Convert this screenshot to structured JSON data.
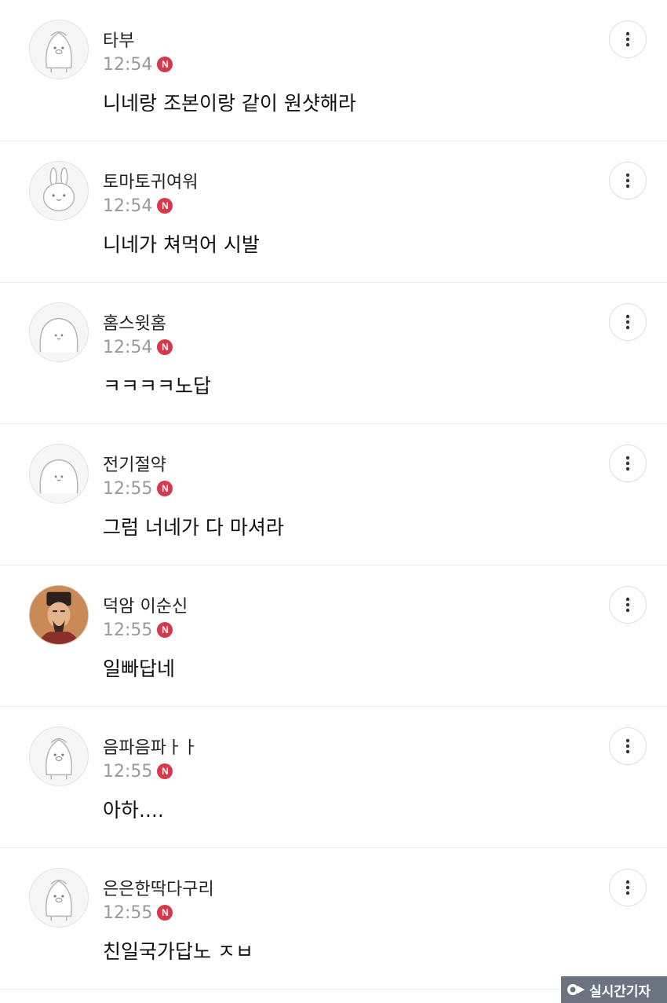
{
  "comments": [
    {
      "nickname": "타부",
      "time": "12:54",
      "badge": "N",
      "body": "니네랑 조본이랑 같이 원샷해라",
      "avatar": "penguin-avatar"
    },
    {
      "nickname": "토마토귀여워",
      "time": "12:54",
      "badge": "N",
      "body": "니네가 쳐먹어 시발",
      "avatar": "rabbit-avatar"
    },
    {
      "nickname": "홈스윗홈",
      "time": "12:54",
      "badge": "N",
      "body": "ㅋㅋㅋㅋ노답",
      "avatar": "blob-avatar"
    },
    {
      "nickname": "전기절약",
      "time": "12:55",
      "badge": "N",
      "body": "그럼 너네가 다 마셔라",
      "avatar": "blob-avatar"
    },
    {
      "nickname": "덕암 이순신",
      "time": "12:55",
      "badge": "N",
      "body": "일빠답네",
      "avatar": "portrait-avatar"
    },
    {
      "nickname": "음파음파ㅏㅏ",
      "time": "12:55",
      "badge": "N",
      "body": "아하....",
      "avatar": "penguin-avatar"
    },
    {
      "nickname": "은은한딱다구리",
      "time": "12:55",
      "badge": "N",
      "body": "친일국가답노 ㅈㅂ",
      "avatar": "penguin-avatar"
    }
  ],
  "watermark": {
    "text": "실시간기자"
  },
  "icons": {
    "more": "more-vertical-icon",
    "new": "new-badge"
  },
  "colors": {
    "badge": "#d6394c",
    "time": "#9a9a9a",
    "divider": "#ececec"
  }
}
